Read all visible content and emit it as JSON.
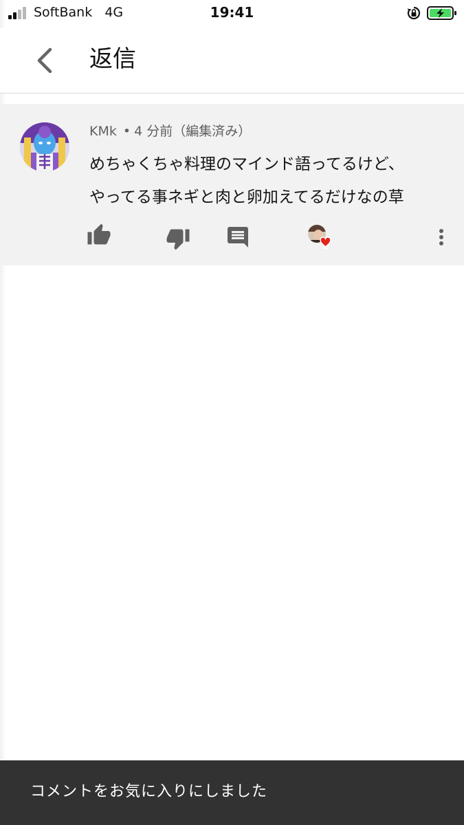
{
  "status_bar": {
    "carrier": "SoftBank",
    "network": "4G",
    "time": "19:41",
    "signal_bars_filled": 2,
    "signal_bars_total": 4,
    "battery_status": "charging",
    "battery_color": "#4cd964",
    "rotation_lock_icon": "rotation-lock-icon"
  },
  "header": {
    "back_icon": "chevron-left-icon",
    "title": "返信"
  },
  "comment": {
    "author": "KMk",
    "separator": "•",
    "time_text": "4 分前（編集済み）",
    "lines": [
      "めちゃくちゃ料理のマインド語ってるけど、",
      "やってる事ネギと肉と卵加えてるだけなの草"
    ],
    "actions": {
      "like_icon": "thumbs-up-icon",
      "dislike_icon": "thumbs-down-icon",
      "reply_icon": "reply-comment-icon",
      "creator_heart_icon": "creator-heart-icon",
      "more_icon": "more-vertical-icon"
    },
    "heart_color": "#e1251b"
  },
  "snackbar": {
    "message": "コメントをお気に入りにしました"
  },
  "colors": {
    "card_background": "#f2f2f2",
    "snackbar_background": "#323232",
    "icon_gray": "#606060"
  }
}
